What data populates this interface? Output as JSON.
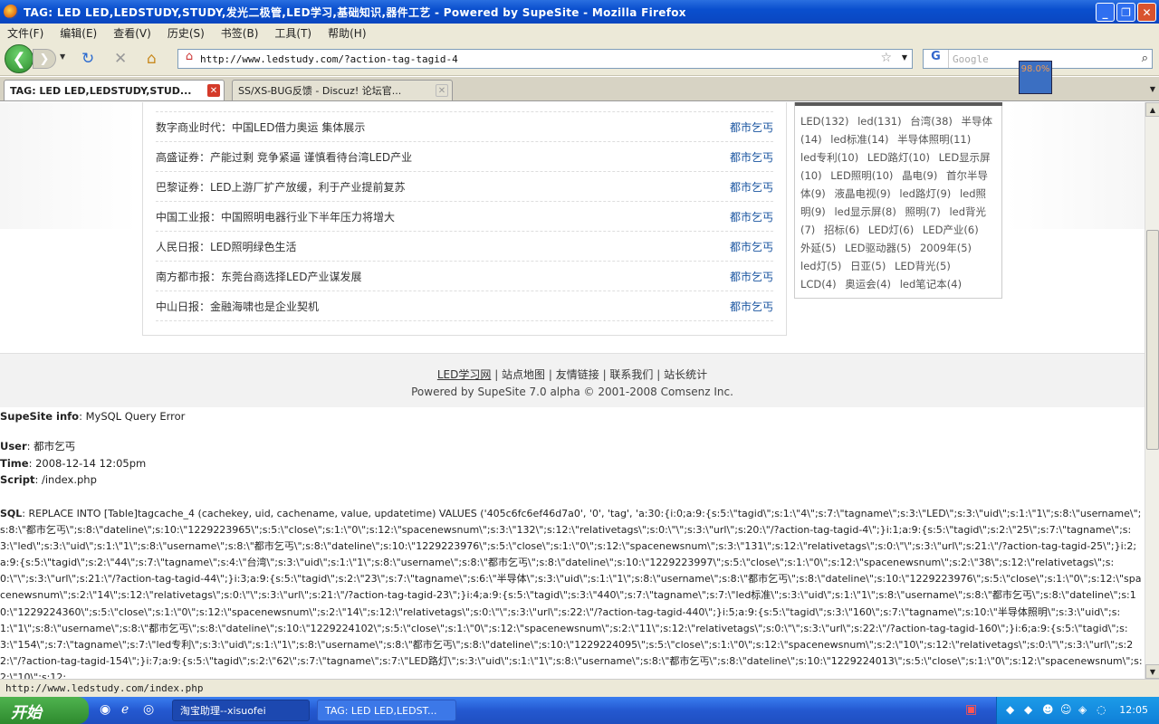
{
  "window": {
    "title": "TAG: LED LED,LEDSTUDY,STUDY,发光二极管,LED学习,基础知识,器件工艺 - Powered by SupeSite - Mozilla Firefox"
  },
  "menu": [
    "文件(F)",
    "编辑(E)",
    "查看(V)",
    "历史(S)",
    "书签(B)",
    "工具(T)",
    "帮助(H)"
  ],
  "nav": {
    "url": "http://www.ledstudy.com/?action-tag-tagid-4",
    "search_placeholder": "Google"
  },
  "tabs": [
    {
      "label": "TAG: LED LED,LEDSTUDY,STUD...",
      "active": true
    },
    {
      "label": "SS/XS-BUG反馈 - Discuz! 论坛官...",
      "active": false
    }
  ],
  "zoom_label": "98.0%",
  "article_list": [
    {
      "title": "数字商业时代：中国LED借力奥运 集体展示",
      "author": "都市乞丐"
    },
    {
      "title": "高盛证券：产能过剩 竞争紧逼 谨慎看待台湾LED产业",
      "author": "都市乞丐"
    },
    {
      "title": "巴黎证券：LED上游厂扩产放缓，利于产业提前复苏",
      "author": "都市乞丐"
    },
    {
      "title": "中国工业报：中国照明电器行业下半年压力将增大",
      "author": "都市乞丐"
    },
    {
      "title": "人民日报：LED照明绿色生活",
      "author": "都市乞丐"
    },
    {
      "title": "南方都市报：东莞台商选择LED产业谋发展",
      "author": "都市乞丐"
    },
    {
      "title": "中山日报：金融海啸也是企业契机",
      "author": "都市乞丐"
    }
  ],
  "tags": [
    "LED(132)",
    "led(131)",
    "台湾(38)",
    "半导体(14)",
    "led标准(14)",
    "半导体照明(11)",
    "led专利(10)",
    "LED路灯(10)",
    "LED显示屏(10)",
    "LED照明(10)",
    "晶电(9)",
    "首尔半导体(9)",
    "液晶电视(9)",
    "led路灯(9)",
    "led照明(9)",
    "led显示屏(8)",
    "照明(7)",
    "led背光(7)",
    "招标(6)",
    "LED灯(6)",
    "LED产业(6)",
    "外延(5)",
    "LED驱动器(5)",
    "2009年(5)",
    "led灯(5)",
    "日亚(5)",
    "LED背光(5)",
    "LCD(4)",
    "奥运会(4)",
    "led笔记本(4)"
  ],
  "footer": {
    "links": [
      "LED学习网",
      "站点地图",
      "友情链接",
      "联系我们",
      "站长统计"
    ],
    "powered": "Powered by SupeSite 7.0 alpha © 2001-2008 Comsenz Inc."
  },
  "error": {
    "info_label": "SupeSite info",
    "info_value": ": MySQL Query Error",
    "user_label": "User",
    "user_value": ": 都市乞丐",
    "time_label": "Time",
    "time_value": ": 2008-12-14 12:05pm",
    "script_label": "Script",
    "script_value": ": /index.php",
    "sql_label": "SQL",
    "sql_value": ": REPLACE INTO [Table]tagcache_4 (cachekey, uid, cachename, value, updatetime) VALUES ('405c6fc6ef46d7a0', '0', 'tag', 'a:30:{i:0;a:9:{s:5:\\\"tagid\\\";s:1:\\\"4\\\";s:7:\\\"tagname\\\";s:3:\\\"LED\\\";s:3:\\\"uid\\\";s:1:\\\"1\\\";s:8:\\\"username\\\";s:8:\\\"都市乞丐\\\";s:8:\\\"dateline\\\";s:10:\\\"1229223965\\\";s:5:\\\"close\\\";s:1:\\\"0\\\";s:12:\\\"spacenewsnum\\\";s:3:\\\"132\\\";s:12:\\\"relativetags\\\";s:0:\\\"\\\";s:3:\\\"url\\\";s:20:\\\"/?action-tag-tagid-4\\\";}i:1;a:9:{s:5:\\\"tagid\\\";s:2:\\\"25\\\";s:7:\\\"tagname\\\";s:3:\\\"led\\\";s:3:\\\"uid\\\";s:1:\\\"1\\\";s:8:\\\"username\\\";s:8:\\\"都市乞丐\\\";s:8:\\\"dateline\\\";s:10:\\\"1229223976\\\";s:5:\\\"close\\\";s:1:\\\"0\\\";s:12:\\\"spacenewsnum\\\";s:3:\\\"131\\\";s:12:\\\"relativetags\\\";s:0:\\\"\\\";s:3:\\\"url\\\";s:21:\\\"/?action-tag-tagid-25\\\";}i:2;a:9:{s:5:\\\"tagid\\\";s:2:\\\"44\\\";s:7:\\\"tagname\\\";s:4:\\\"台湾\\\";s:3:\\\"uid\\\";s:1:\\\"1\\\";s:8:\\\"username\\\";s:8:\\\"都市乞丐\\\";s:8:\\\"dateline\\\";s:10:\\\"1229223997\\\";s:5:\\\"close\\\";s:1:\\\"0\\\";s:12:\\\"spacenewsnum\\\";s:2:\\\"38\\\";s:12:\\\"relativetags\\\";s:0:\\\"\\\";s:3:\\\"url\\\";s:21:\\\"/?action-tag-tagid-44\\\";}i:3;a:9:{s:5:\\\"tagid\\\";s:2:\\\"23\\\";s:7:\\\"tagname\\\";s:6:\\\"半导体\\\";s:3:\\\"uid\\\";s:1:\\\"1\\\";s:8:\\\"username\\\";s:8:\\\"都市乞丐\\\";s:8:\\\"dateline\\\";s:10:\\\"1229223976\\\";s:5:\\\"close\\\";s:1:\\\"0\\\";s:12:\\\"spacenewsnum\\\";s:2:\\\"14\\\";s:12:\\\"relativetags\\\";s:0:\\\"\\\";s:3:\\\"url\\\";s:21:\\\"/?action-tag-tagid-23\\\";}i:4;a:9:{s:5:\\\"tagid\\\";s:3:\\\"440\\\";s:7:\\\"tagname\\\";s:7:\\\"led标准\\\";s:3:\\\"uid\\\";s:1:\\\"1\\\";s:8:\\\"username\\\";s:8:\\\"都市乞丐\\\";s:8:\\\"dateline\\\";s:10:\\\"1229224360\\\";s:5:\\\"close\\\";s:1:\\\"0\\\";s:12:\\\"spacenewsnum\\\";s:2:\\\"14\\\";s:12:\\\"relativetags\\\";s:0:\\\"\\\";s:3:\\\"url\\\";s:22:\\\"/?action-tag-tagid-440\\\";}i:5;a:9:{s:5:\\\"tagid\\\";s:3:\\\"160\\\";s:7:\\\"tagname\\\";s:10:\\\"半导体照明\\\";s:3:\\\"uid\\\";s:1:\\\"1\\\";s:8:\\\"username\\\";s:8:\\\"都市乞丐\\\";s:8:\\\"dateline\\\";s:10:\\\"1229224102\\\";s:5:\\\"close\\\";s:1:\\\"0\\\";s:12:\\\"spacenewsnum\\\";s:2:\\\"11\\\";s:12:\\\"relativetags\\\";s:0:\\\"\\\";s:3:\\\"url\\\";s:22:\\\"/?action-tag-tagid-160\\\";}i:6;a:9:{s:5:\\\"tagid\\\";s:3:\\\"154\\\";s:7:\\\"tagname\\\";s:7:\\\"led专利\\\";s:3:\\\"uid\\\";s:1:\\\"1\\\";s:8:\\\"username\\\";s:8:\\\"都市乞丐\\\";s:8:\\\"dateline\\\";s:10:\\\"1229224095\\\";s:5:\\\"close\\\";s:1:\\\"0\\\";s:12:\\\"spacenewsnum\\\";s:2:\\\"10\\\";s:12:\\\"relativetags\\\";s:0:\\\"\\\";s:3:\\\"url\\\";s:22:\\\"/?action-tag-tagid-154\\\";}i:7;a:9:{s:5:\\\"tagid\\\";s:2:\\\"62\\\";s:7:\\\"tagname\\\";s:7:\\\"LED路灯\\\";s:3:\\\"uid\\\";s:1:\\\"1\\\";s:8:\\\"username\\\";s:8:\\\"都市乞丐\\\";s:8:\\\"dateline\\\";s:10:\\\"1229224013\\\";s:5:\\\"close\\\";s:1:\\\"0\\\";s:12:\\\"spacenewsnum\\\";s:2:\\\"10\\\";s:12:"
  },
  "status_bar": "http://www.ledstudy.com/index.php",
  "taskbar": {
    "start": "开始",
    "tasks": [
      "淘宝助理--xisuofei",
      "TAG: LED LED,LEDST..."
    ],
    "clock": "12:05"
  }
}
